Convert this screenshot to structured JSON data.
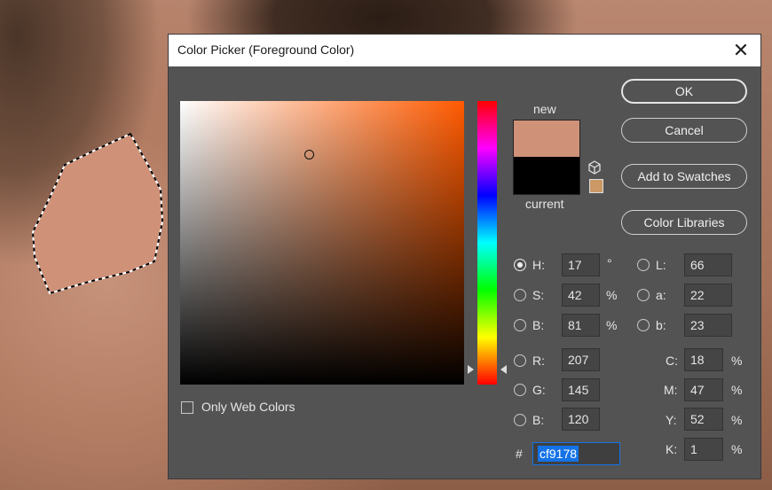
{
  "dialog": {
    "title": "Color Picker (Foreground Color)",
    "close_glyph": "✕",
    "new_label": "new",
    "current_label": "current",
    "new_color": "#cf9178",
    "current_color": "#000000",
    "only_web_colors_label": "Only Web Colors"
  },
  "buttons": {
    "ok": "OK",
    "cancel": "Cancel",
    "add_to_swatches": "Add to Swatches",
    "color_libraries": "Color Libraries"
  },
  "hsb": {
    "h_label": "H:",
    "h_value": "17",
    "h_unit": "°",
    "s_label": "S:",
    "s_value": "42",
    "s_unit": "%",
    "b_label": "B:",
    "b_value": "81",
    "b_unit": "%"
  },
  "rgb": {
    "r_label": "R:",
    "r_value": "207",
    "g_label": "G:",
    "g_value": "145",
    "b_label": "B:",
    "b_value": "120"
  },
  "lab": {
    "l_label": "L:",
    "l_value": "66",
    "a_label": "a:",
    "a_value": "22",
    "b_label": "b:",
    "b_value": "23"
  },
  "cmyk": {
    "c_label": "C:",
    "c_value": "18",
    "c_unit": "%",
    "m_label": "M:",
    "m_value": "47",
    "m_unit": "%",
    "y_label": "Y:",
    "y_value": "52",
    "y_unit": "%",
    "k_label": "K:",
    "k_value": "1",
    "k_unit": "%"
  },
  "hex": {
    "label": "#",
    "value": "cf9178"
  },
  "icons": {
    "close": "close-icon",
    "out_of_gamut": "cube-icon",
    "hue_slider": "triangle-arrow-icon"
  },
  "selection_fill": "#cf9178",
  "field_hue_color": "#ff5a00"
}
